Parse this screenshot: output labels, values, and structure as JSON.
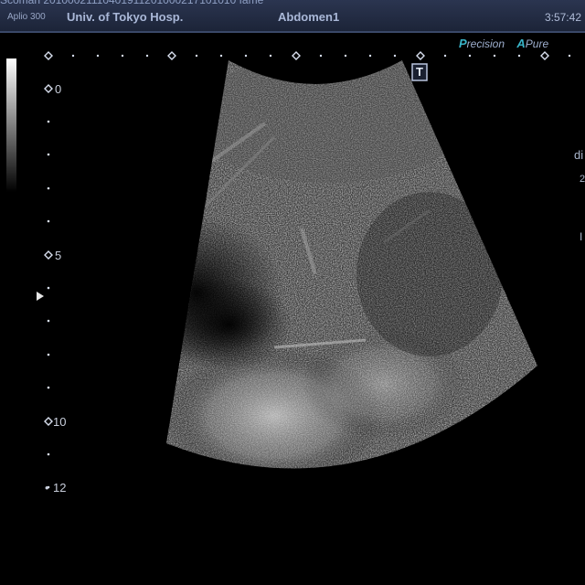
{
  "header": {
    "cut_text": "Scoman 20100021110401911201000217101010 fame",
    "model": "Aplio 300",
    "hospital": "Univ. of Tokyo Hosp.",
    "preset": "Abdomen1",
    "time": "3:57:42"
  },
  "modes": [
    {
      "letter": "P",
      "rest": "recision"
    },
    {
      "letter": "A",
      "rest": "Pure"
    }
  ],
  "depth_scale": {
    "labels": [
      "0",
      "5",
      "10",
      "12"
    ],
    "unit": "cm"
  },
  "badge": {
    "letter": "T"
  },
  "right_panel": {
    "line1": "di",
    "line2": "2",
    "line3": "I"
  },
  "colors": {
    "header_bg": "#2b3550",
    "header_text": "#aab8d8",
    "mode_accent": "#39b4c8",
    "scale_text": "#c8cedb"
  }
}
